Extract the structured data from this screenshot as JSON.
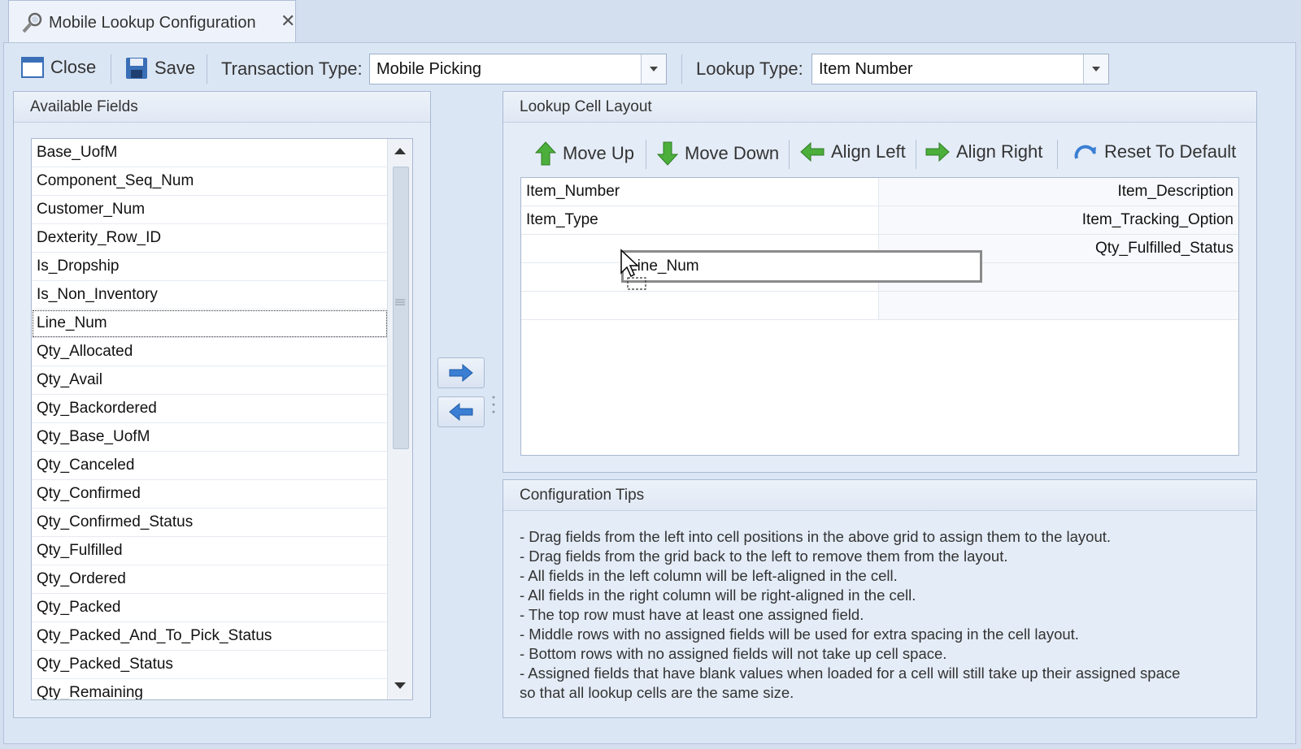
{
  "tab": {
    "title": "Mobile Lookup Configuration",
    "close_glyph": "✕"
  },
  "toolbar": {
    "close_label": "Close",
    "save_label": "Save",
    "transaction_type_label": "Transaction Type:",
    "transaction_type_value": "Mobile Picking",
    "lookup_type_label": "Lookup Type:",
    "lookup_type_value": "Item Number"
  },
  "available_fields": {
    "title": "Available Fields",
    "items": [
      "Base_UofM",
      "Component_Seq_Num",
      "Customer_Num",
      "Dexterity_Row_ID",
      "Is_Dropship",
      "Is_Non_Inventory",
      "Line_Num",
      "Qty_Allocated",
      "Qty_Avail",
      "Qty_Backordered",
      "Qty_Base_UofM",
      "Qty_Canceled",
      "Qty_Confirmed",
      "Qty_Confirmed_Status",
      "Qty_Fulfilled",
      "Qty_Ordered",
      "Qty_Packed",
      "Qty_Packed_And_To_Pick_Status",
      "Qty_Packed_Status",
      "Qty_Remaining"
    ],
    "selected": "Line_Num"
  },
  "layout": {
    "title": "Lookup Cell Layout",
    "move_up_label": "Move Up",
    "move_down_label": "Move Down",
    "align_left_label": "Align Left",
    "align_right_label": "Align Right",
    "reset_label": "Reset To Default",
    "rows": [
      {
        "left": "Item_Number",
        "right": "Item_Description"
      },
      {
        "left": "Item_Type",
        "right": "Item_Tracking_Option"
      },
      {
        "left": "",
        "right": "Qty_Fulfilled_Status"
      },
      {
        "left": "",
        "right": ""
      },
      {
        "left": "",
        "right": ""
      }
    ],
    "drag_text": "Line_Num"
  },
  "tips": {
    "title": "Configuration Tips",
    "lines": [
      "- Drag fields from the left into cell positions in the above grid to assign them to the layout.",
      "- Drag fields from the grid back to the left to remove them from the layout.",
      "- All fields in the left column will be left-aligned in the cell.",
      "- All fields in the right column will be right-aligned in the cell.",
      "- The top row must have at least one assigned field.",
      "- Middle rows with no assigned fields will be used for extra spacing in the cell layout.",
      "- Bottom rows with no assigned fields will not take up cell space.",
      "- Assigned fields that have blank values when loaded for a cell will still take up their assigned space",
      "so that all lookup cells are the same size."
    ]
  },
  "icons": {
    "close": "close-window-icon",
    "save": "save-disk-icon",
    "move_up": "arrow-up-icon",
    "move_down": "arrow-down-icon",
    "align_left": "arrow-left-icon",
    "align_right": "arrow-right-icon",
    "reset": "reset-icon",
    "add": "arrow-right-icon",
    "remove": "arrow-left-icon"
  },
  "colors": {
    "accent_blue": "#3b7fd4",
    "green_arrow": "#4cae3b"
  }
}
